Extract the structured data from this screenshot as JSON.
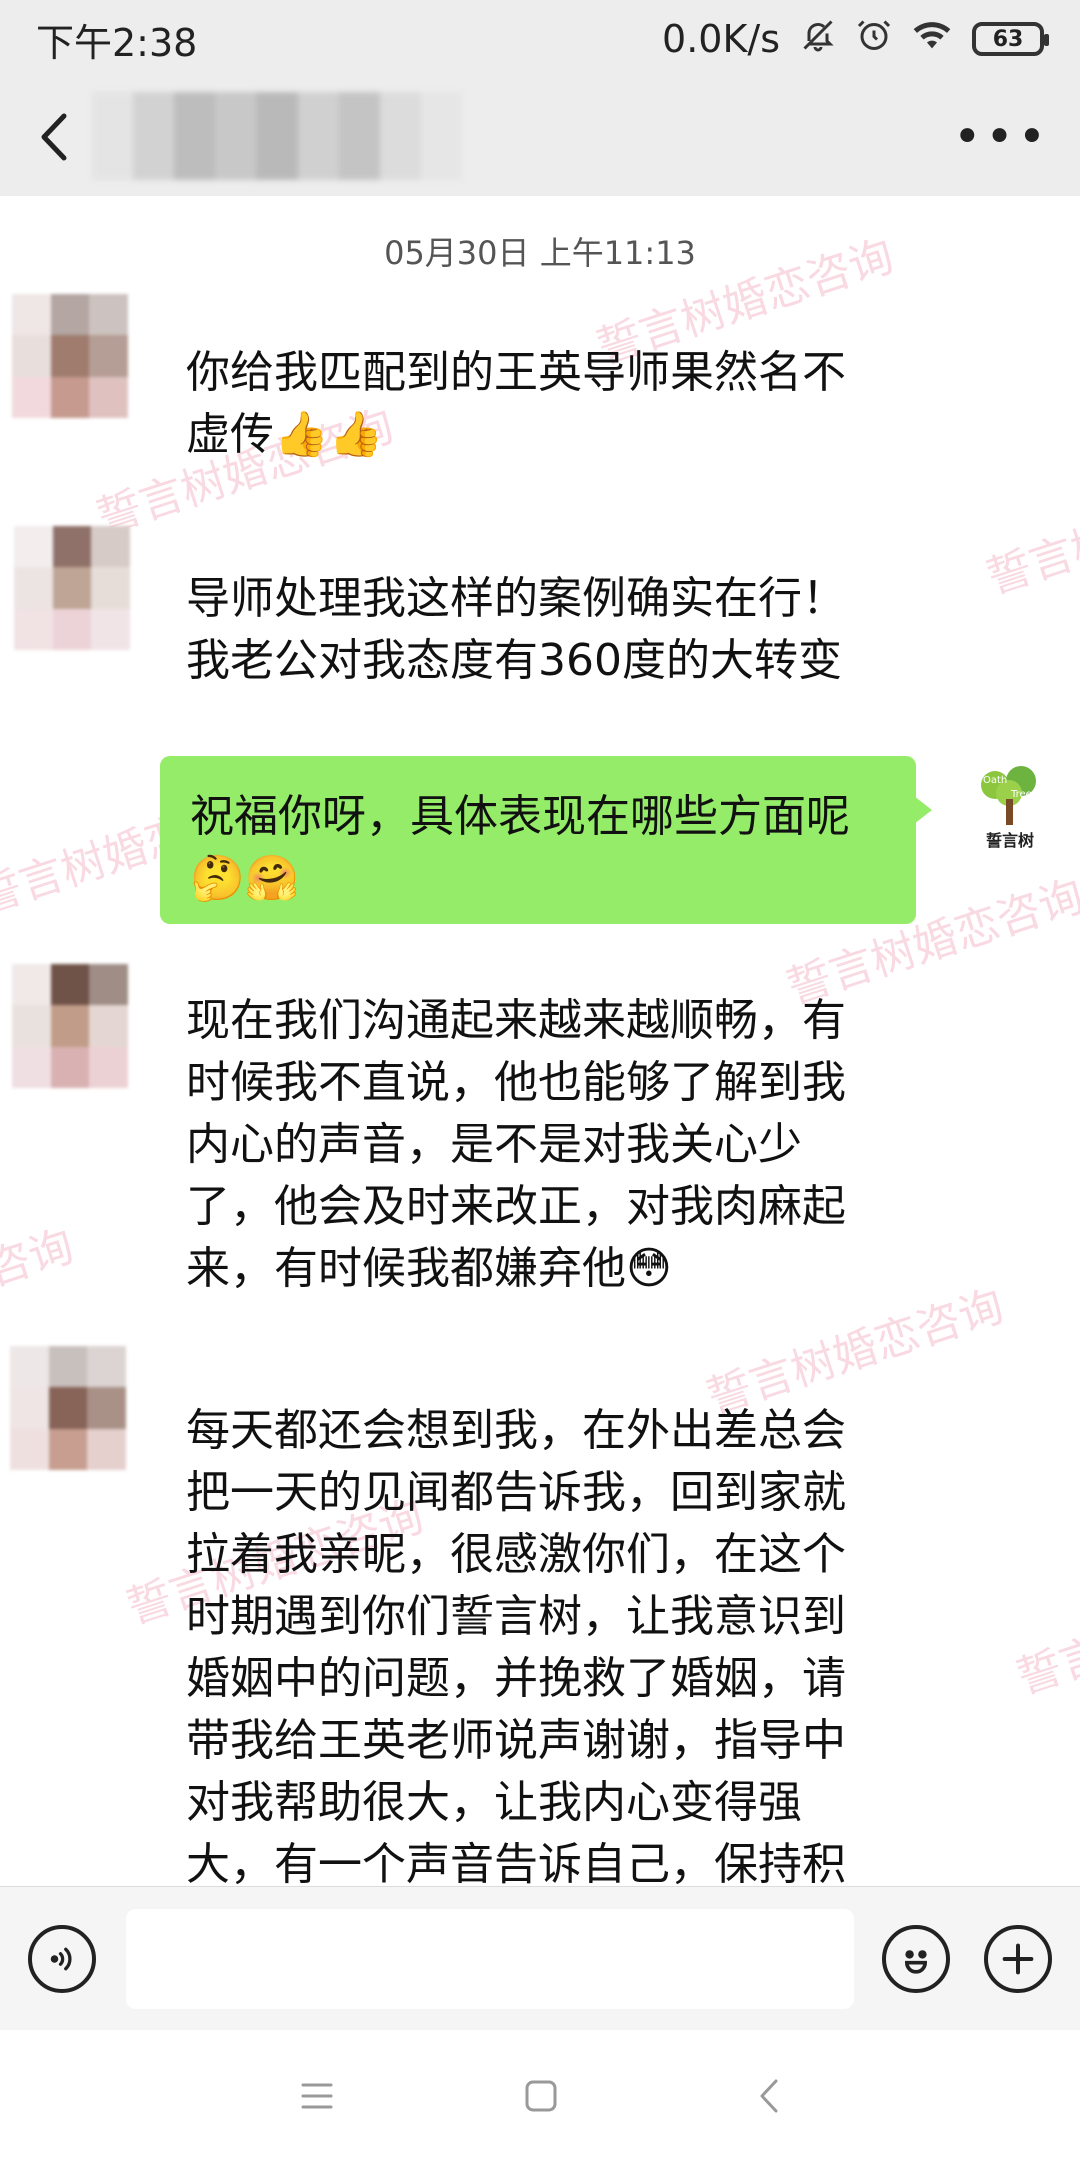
{
  "status_bar": {
    "time": "下午2:38",
    "net_speed": "0.0K/s",
    "battery": "63"
  },
  "chat": {
    "timestamp": "05月30日 上午11:13",
    "watermark_text": "誓言树婚恋咨询",
    "messages": [
      {
        "side": "left",
        "text": "你给我匹配到的王英导师果然名不虚传👍👍"
      },
      {
        "side": "left",
        "text": "导师处理我这样的案例确实在行！我老公对我态度有360度的大转变"
      },
      {
        "side": "right",
        "text": "祝福你呀，具体表现在哪些方面呢🤔🤗"
      },
      {
        "side": "left",
        "text": "现在我们沟通起来越来越顺畅，有时候我不直说，他也能够了解到我内心的声音，是不是对我关心少了，他会及时来改正，对我肉麻起来，有时候我都嫌弃他😳"
      },
      {
        "side": "left",
        "text": "每天都还会想到我，在外出差总会把一天的见闻都告诉我，回到家就拉着我亲昵，很感激你们，在这个时期遇到你们誓言树，让我意识到婚姻中的问题，并挽救了婚姻，请带我给王英老师说声谢谢，指导中对我帮助很大，让我内心变得强大，有一个声音告诉自己，保持积"
      }
    ],
    "logo": {
      "brand_top": "Oath",
      "brand_sub": "Tree",
      "brand_cn": "誓言树"
    }
  },
  "input_bar": {
    "value": "",
    "icons": [
      "voice-icon",
      "emoji-icon",
      "plus-icon"
    ]
  },
  "colors": {
    "bubble_green": "#95ec69",
    "background": "#ededed",
    "chat_bg": "#ffffff",
    "watermark": "#eb7896"
  }
}
